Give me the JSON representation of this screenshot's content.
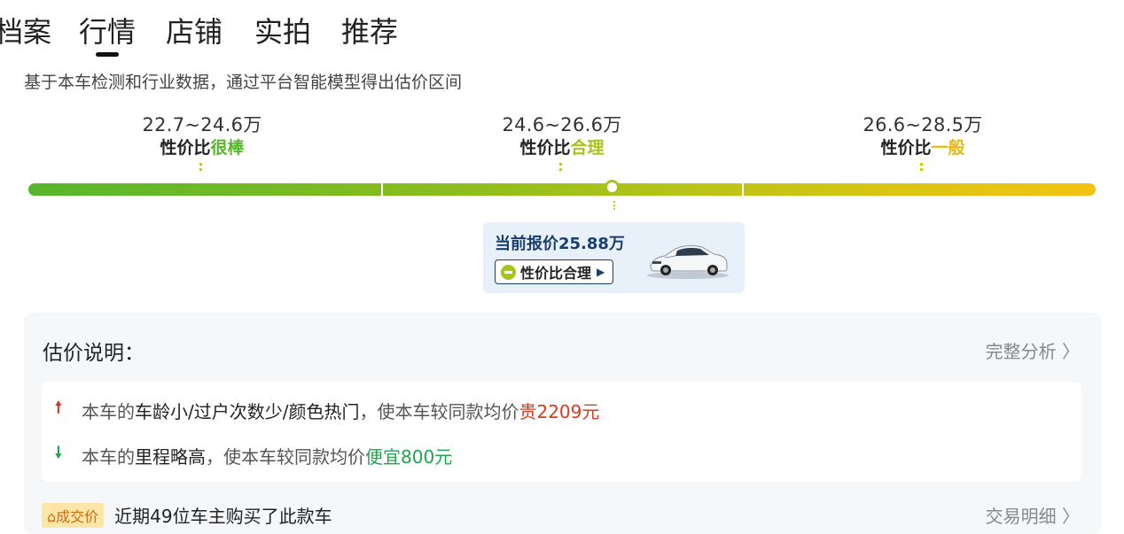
{
  "tabs": [
    "档案",
    "行情",
    "店铺",
    "实拍",
    "推荐"
  ],
  "active_tab": "行情",
  "subtitle": "基于本车检测和行业数据，通过平台智能模型得出估价区间",
  "segments": [
    {
      "range": "22.7~24.6万",
      "prefix": "性价比",
      "grade": "很棒",
      "color": "#58b62c"
    },
    {
      "range": "24.6~26.6万",
      "prefix": "性价比",
      "grade": "合理",
      "color": "#a8c41c"
    },
    {
      "range": "26.6~28.5万",
      "prefix": "性价比",
      "grade": "一般",
      "color": "#e8b810"
    }
  ],
  "current_price": {
    "text": "当前报价25.88万",
    "button": "性价比合理",
    "button_icon": "smile-icon",
    "arrow_icon": "triangle-right-icon"
  },
  "explanation": {
    "title": "估价说明：",
    "link": "完整分析 〉",
    "reasons": [
      {
        "direction": "up",
        "lead": "本车的",
        "factor": "车龄小/过户次数少/颜色热门",
        "mid": "，使本车较同款均价",
        "result": "贵2209元"
      },
      {
        "direction": "down",
        "lead": "本车的",
        "factor": "里程略高",
        "mid": "，使本车较同款均价",
        "result": "便宜800元"
      }
    ],
    "deal_badge": "成交价",
    "deal_text": "近期49位车主购买了此款车",
    "deal_link": "交易明细 〉"
  }
}
